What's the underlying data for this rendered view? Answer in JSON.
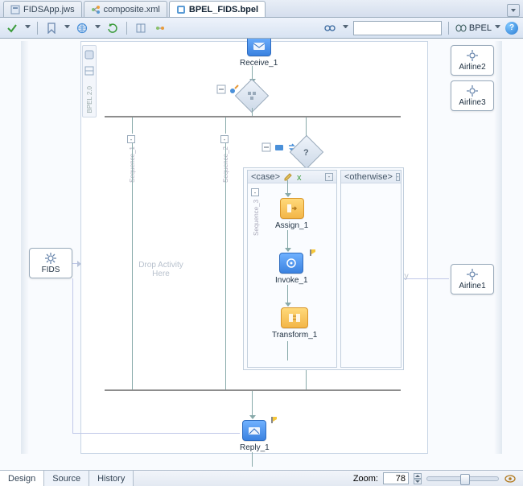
{
  "tabs": [
    {
      "label": "FIDSApp.jws",
      "icon": "app-icon"
    },
    {
      "label": "composite.xml",
      "icon": "composite-icon"
    },
    {
      "label": "BPEL_FIDS.bpel",
      "icon": "bpel-icon",
      "active": true
    }
  ],
  "toolbar": {
    "bpel_menu_label": "BPEL",
    "binoculars_title": "Find"
  },
  "partners": {
    "left": {
      "label": "FIDS"
    },
    "right": [
      {
        "label": "Airline2"
      },
      {
        "label": "Airline3"
      },
      {
        "label": "Airline1"
      }
    ]
  },
  "palette_label": "BPEL 2.0",
  "activities": {
    "receive": {
      "label": "Receive_1"
    },
    "assign": {
      "label": "Assign_1"
    },
    "invoke": {
      "label": "Invoke_1"
    },
    "transform": {
      "label": "Transform_1"
    },
    "reply": {
      "label": "Reply_1"
    }
  },
  "switch_node": {
    "case_label": "<case>",
    "otherwise_label": "<otherwise>"
  },
  "sequences": {
    "seq1": "Sequence_1",
    "seq2": "Sequence_2",
    "seq3": "Sequence_3"
  },
  "hints": {
    "drop": "Drop Activity Here"
  },
  "status": {
    "tabs": [
      "Design",
      "Source",
      "History"
    ],
    "active_tab": "Design",
    "zoom_label": "Zoom:",
    "zoom_value": "78",
    "slider_pct": 52
  }
}
